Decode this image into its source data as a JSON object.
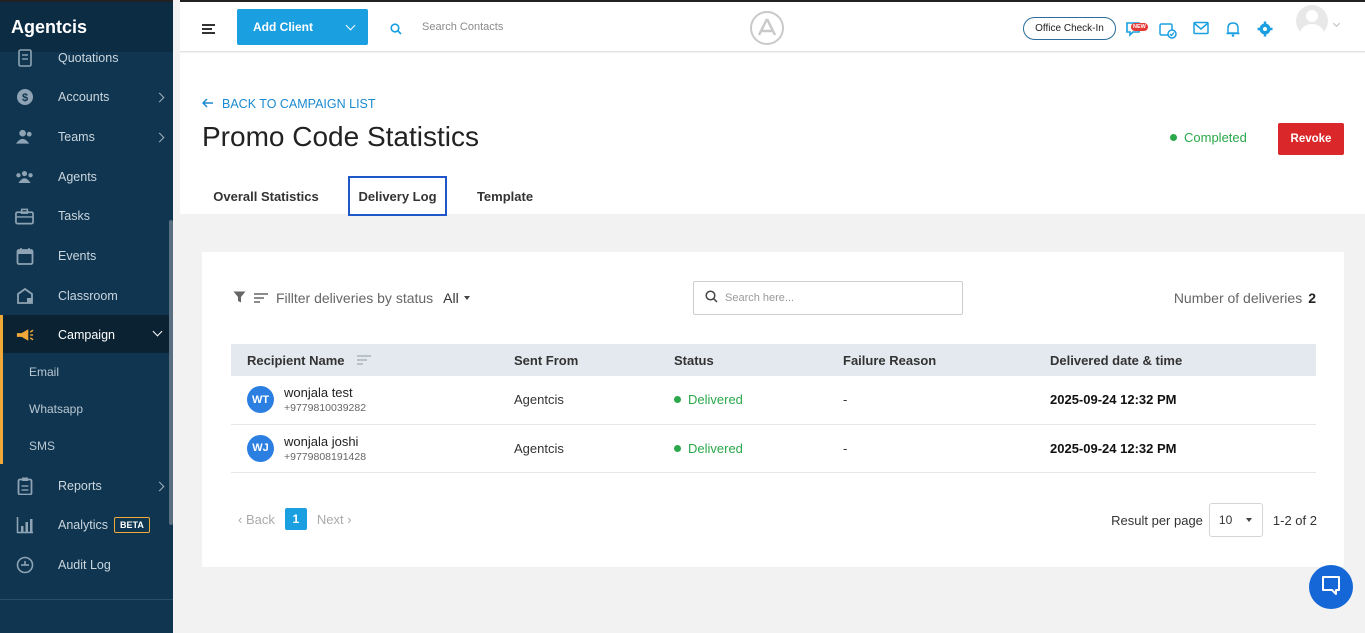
{
  "brand": "Agentcis",
  "sidebar": {
    "items": [
      {
        "label": "Quotations",
        "icon": "document-icon"
      },
      {
        "label": "Accounts",
        "icon": "dollar-icon"
      },
      {
        "label": "Teams",
        "icon": "team-icon"
      },
      {
        "label": "Agents",
        "icon": "agents-icon"
      },
      {
        "label": "Tasks",
        "icon": "briefcase-icon"
      },
      {
        "label": "Events",
        "icon": "calendar-icon"
      },
      {
        "label": "Classroom",
        "icon": "classroom-icon"
      },
      {
        "label": "Campaign",
        "icon": "megaphone-icon"
      },
      {
        "label": "Reports",
        "icon": "clipboard-icon"
      },
      {
        "label": "Analytics",
        "icon": "analytics-icon"
      },
      {
        "label": "Audit Log",
        "icon": "audit-icon"
      }
    ],
    "campaign_sub": [
      "Email",
      "Whatsapp",
      "SMS"
    ],
    "beta_badge": "BETA"
  },
  "topbar": {
    "add_client": "Add Client",
    "search_placeholder": "Search Contacts",
    "office_checkin": "Office Check-In",
    "new_badge": "NEW"
  },
  "header": {
    "back_link": "BACK TO CAMPAIGN LIST",
    "title": "Promo Code Statistics",
    "status": "Completed",
    "revoke": "Revoke",
    "tabs": [
      "Overall Statistics",
      "Delivery Log",
      "Template"
    ]
  },
  "filter": {
    "label": "Fillter deliveries by status",
    "value": "All",
    "search_placeholder": "Search here...",
    "count_label": "Number of deliveries",
    "count_value": "2"
  },
  "table": {
    "headers": [
      "Recipient Name",
      "Sent From",
      "Status",
      "Failure Reason",
      "Delivered date & time"
    ],
    "rows": [
      {
        "initials": "WT",
        "name": "wonjala test",
        "phone": "+9779810039282",
        "sent_from": "Agentcis",
        "status": "Delivered",
        "failure": "-",
        "datetime": "2025-09-24 12:32 PM"
      },
      {
        "initials": "WJ",
        "name": "wonjala joshi",
        "phone": "+9779808191428",
        "sent_from": "Agentcis",
        "status": "Delivered",
        "failure": "-",
        "datetime": "2025-09-24 12:32 PM"
      }
    ]
  },
  "pagination": {
    "back": "Back",
    "page": "1",
    "next": "Next",
    "per_page_label": "Result per page",
    "per_page_value": "10",
    "range": "1-2 of 2"
  },
  "colors": {
    "sidebar": "#0f3550",
    "accent": "#1a9fe0",
    "active_marker": "#f0a838",
    "success": "#2aa84a",
    "danger": "#d9272a",
    "tab_highlight": "#1f57c9"
  }
}
